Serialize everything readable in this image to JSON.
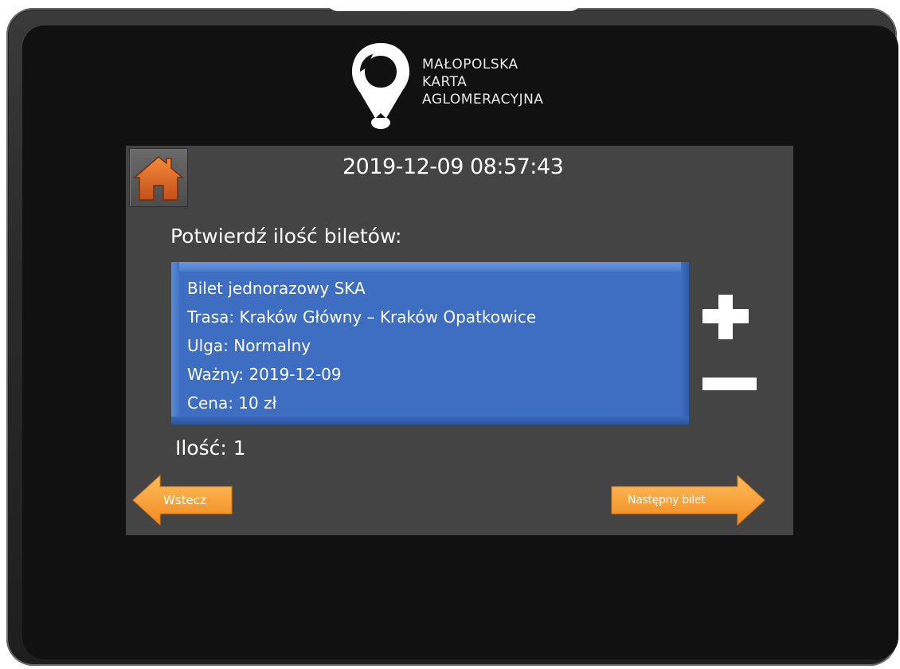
{
  "branding": {
    "logo_line1": "MAŁOPOLSKA",
    "logo_line2": "KARTA",
    "logo_line3": "AGLOMERACYJNA",
    "logo_icon": "map-pin-logo-icon"
  },
  "header": {
    "datetime": "2019-12-09 08:57:43",
    "home_icon": "home-icon"
  },
  "main": {
    "prompt": "Potwierdź ilość biletów:",
    "ticket": {
      "line1": "Bilet jednorazowy SKA",
      "line2": "Trasa: Kraków Główny – Kraków Opatkowice",
      "line3": "Ulga: Normalny",
      "line4": "Ważny: 2019-12-09",
      "line5": "Cena: 10 zł"
    },
    "quantity_label": "Ilość: 1",
    "plus_icon": "plus-icon",
    "minus_icon": "minus-icon"
  },
  "nav": {
    "back_label": "Wstecz",
    "next_label": "Następny bilet"
  },
  "colors": {
    "accent_orange": "#f7a33a",
    "ticket_blue": "#3e6ec2",
    "panel_gray": "#444444",
    "screen_black": "#111111"
  }
}
